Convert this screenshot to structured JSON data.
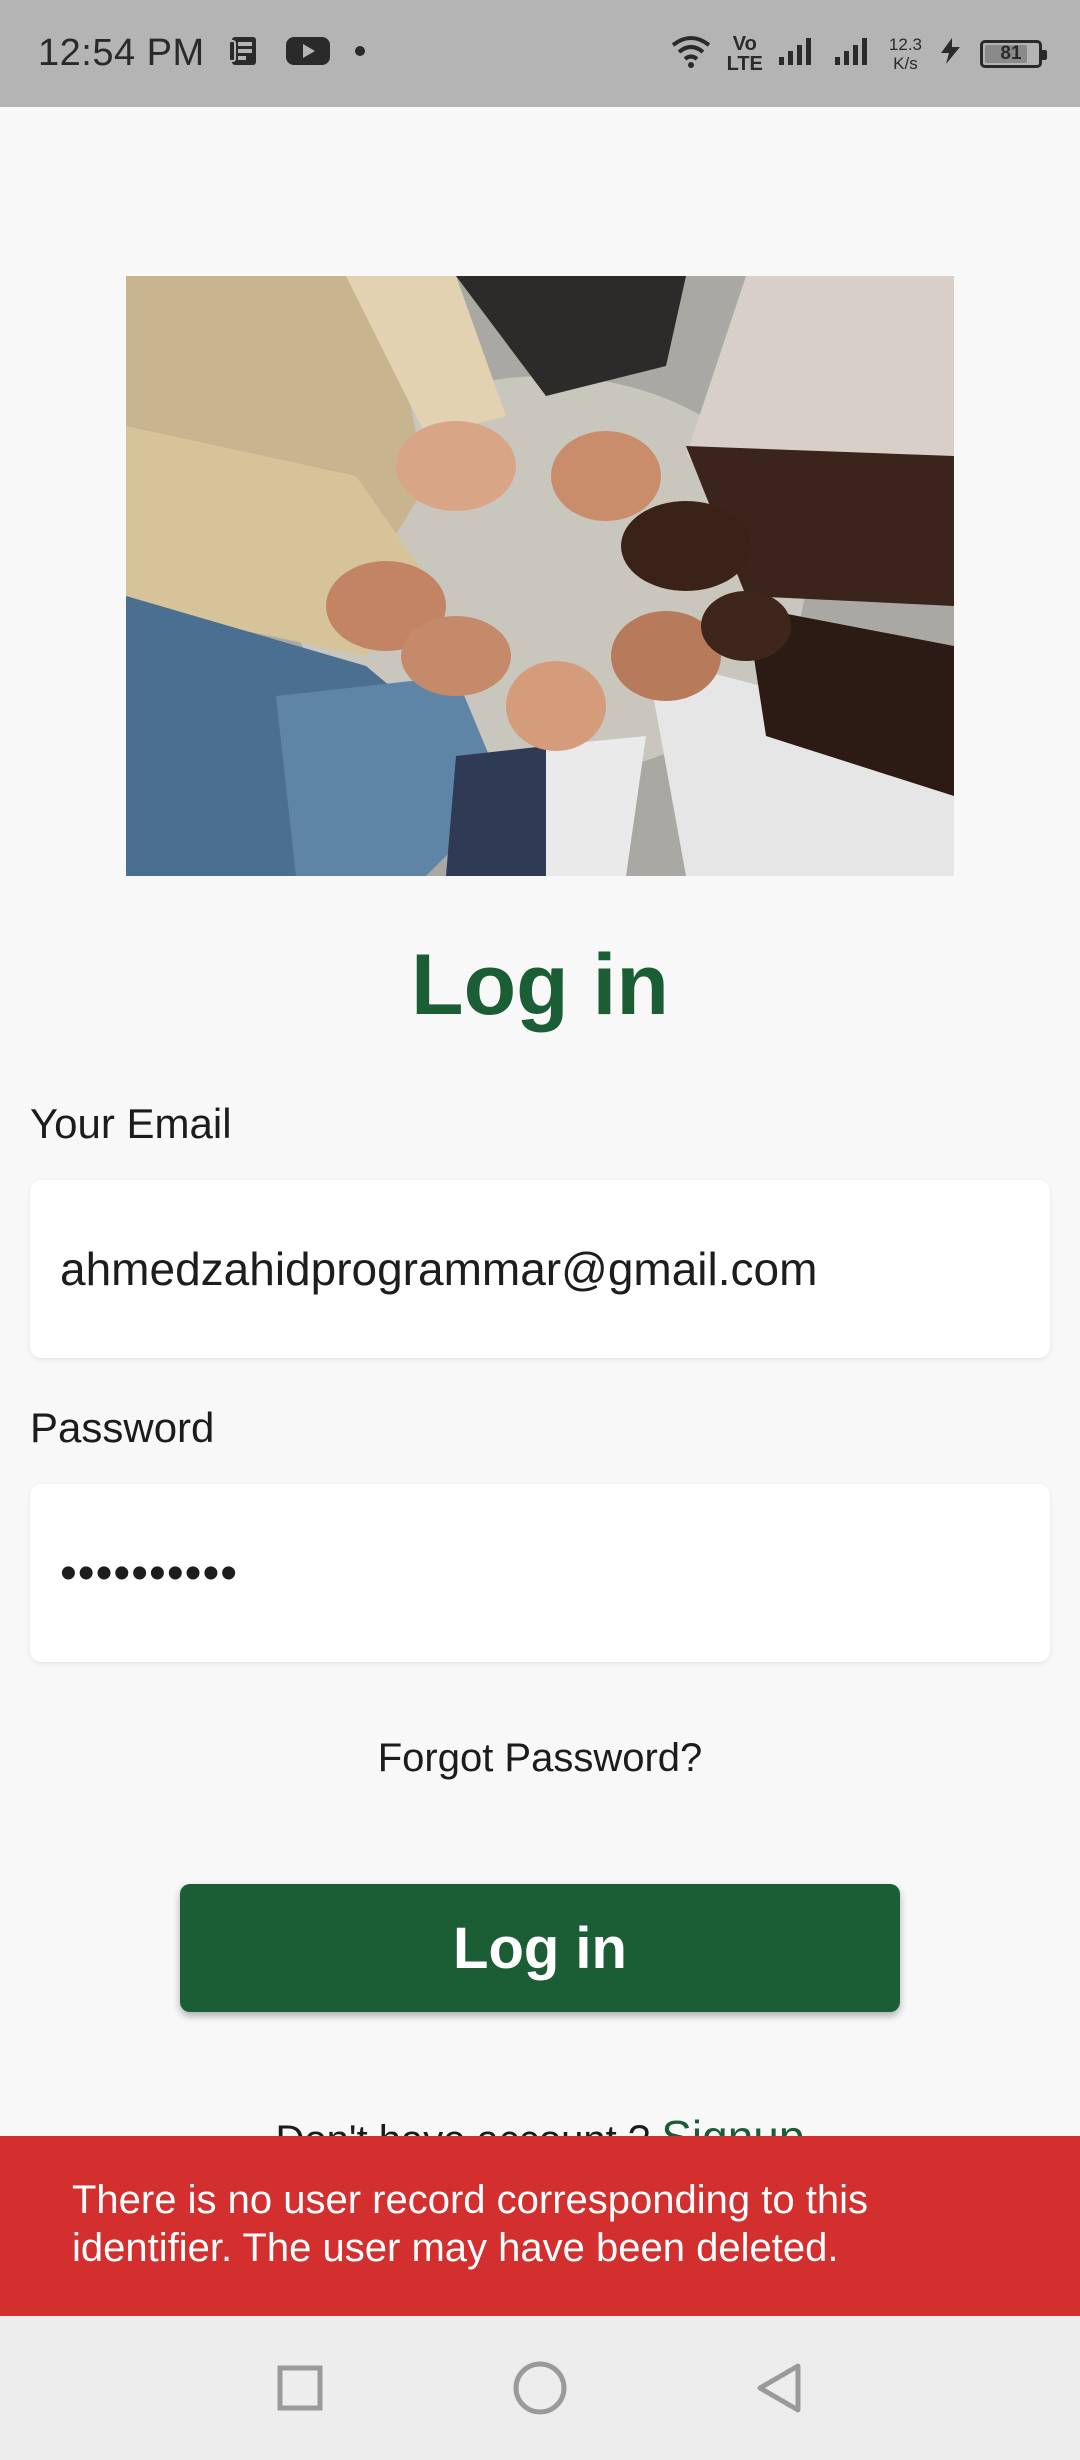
{
  "status_bar": {
    "time": "12:54 PM",
    "network_label_top": "Vo",
    "network_label_bottom": "LTE",
    "speed_value": "12.3",
    "speed_unit": "K/s",
    "battery_level": "81"
  },
  "login": {
    "title": "Log in",
    "email_label": "Your Email",
    "email_value": "ahmedzahidprogrammar@gmail.com",
    "password_label": "Password",
    "password_value": "••••••••••",
    "forgot_password": "Forgot Password?",
    "submit_label": "Log in",
    "signup_prompt": "Don't have account ? ",
    "signup_link": "Signup"
  },
  "snackbar": {
    "message": "There is no user record corresponding to this identifier. The user may have been deleted."
  },
  "colors": {
    "brand_green": "#1b5e35",
    "error_red": "#d32f2f",
    "status_bar_bg": "#b4b4b4",
    "nav_bar_bg": "#ededed"
  }
}
